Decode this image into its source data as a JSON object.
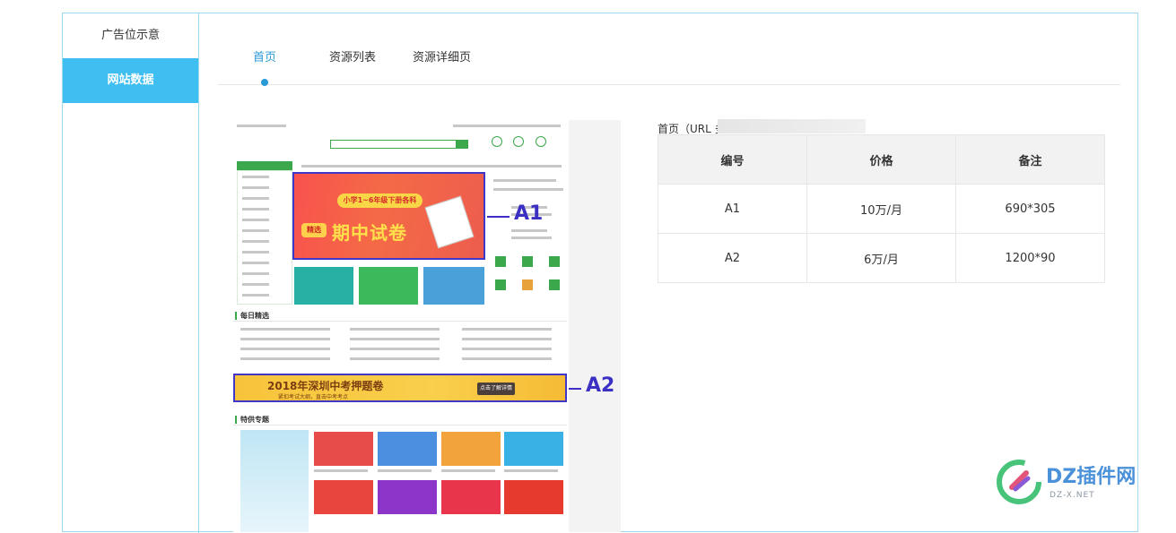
{
  "sidebar": {
    "items": [
      {
        "label": "广告位示意"
      },
      {
        "label": "网站数据"
      }
    ]
  },
  "tabs": [
    {
      "label": "首页"
    },
    {
      "label": "资源列表"
    },
    {
      "label": "资源详细页"
    }
  ],
  "preview": {
    "banner_a1": {
      "tag": "小学1~6年级下册各科",
      "badge": "精选",
      "headline": "期中试卷"
    },
    "banner_a2": {
      "headline": "2018年深圳中考押题卷",
      "subline": "紧扣考试大纲，直击中考考点",
      "button": "点击了解详情"
    },
    "marker_a1": "A1",
    "marker_a2": "A2",
    "section_daily": "每日精选",
    "section_special": "特供专题"
  },
  "info": {
    "caption": "首页（URL 多"
  },
  "table": {
    "headers": [
      "编号",
      "价格",
      "备注"
    ],
    "rows": [
      [
        "A1",
        "10万/月",
        "690*305"
      ],
      [
        "A2",
        "6万/月",
        "1200*90"
      ]
    ]
  },
  "watermark": {
    "text": "DZ插件网",
    "sub": "DZ-X.NET"
  },
  "colors": {
    "accent": "#3ebef1",
    "tab_active": "#2a9ad6",
    "marker": "#3b2fc4"
  }
}
